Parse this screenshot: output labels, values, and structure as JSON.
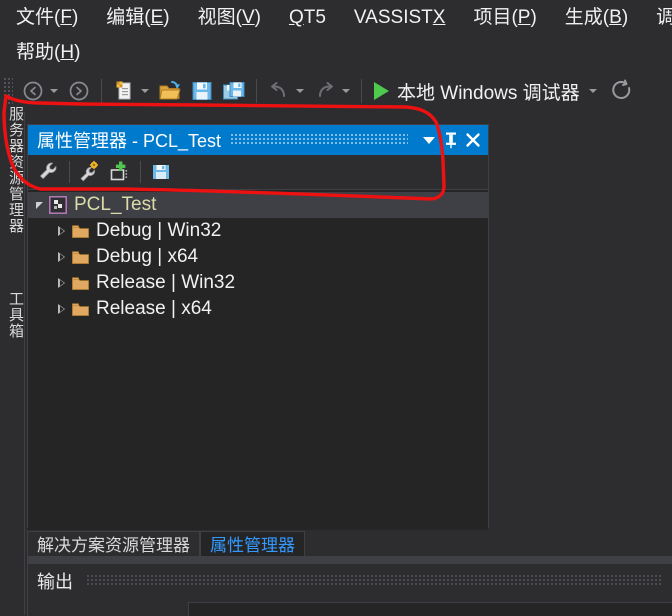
{
  "app": {
    "theme_background": "#2d2d30",
    "accent": "#007acc",
    "panel_background": "#252526"
  },
  "menubar": {
    "items": [
      {
        "name": "file",
        "text": "文件(F)",
        "pre": "文件(",
        "accel": "F",
        "post": ")"
      },
      {
        "name": "edit",
        "text": "编辑(E)",
        "pre": "编辑(",
        "accel": "E",
        "post": ")"
      },
      {
        "name": "view",
        "text": "视图(V)",
        "pre": "视图(",
        "accel": "V",
        "post": ")"
      },
      {
        "name": "qt5",
        "text": "QT5",
        "pre": "",
        "accel": "Q",
        "post": "T5"
      },
      {
        "name": "vassistx",
        "text": "VASSISTX",
        "pre": "VASSIST",
        "accel": "X",
        "post": ""
      },
      {
        "name": "project",
        "text": "项目(P)",
        "pre": "项目(",
        "accel": "P",
        "post": ")"
      },
      {
        "name": "build",
        "text": "生成(B)",
        "pre": "生成(",
        "accel": "B",
        "post": ")"
      },
      {
        "name": "debug",
        "text": "调试(D",
        "pre": "调试(",
        "accel": "D",
        "post": ""
      },
      {
        "name": "help",
        "text": "帮助(H)",
        "pre": "帮助(",
        "accel": "H",
        "post": ")"
      }
    ]
  },
  "toolbar": {
    "back_label": "navigate-backward",
    "forward_label": "navigate-forward",
    "new_label": "new-project",
    "open_label": "open-file",
    "save_label": "save",
    "save_all_label": "save-all",
    "undo_label": "undo",
    "redo_label": "redo",
    "run_label": "本地 Windows 调试器",
    "refresh_label": "refresh"
  },
  "left_strip": {
    "tabs": [
      {
        "name": "server-explorer",
        "label": "服务器资源管理器"
      },
      {
        "name": "toolbox",
        "label": "工具箱"
      }
    ]
  },
  "panel": {
    "title": "属性管理器 - PCL_Test",
    "dropdown_label": "window-menu",
    "pin_label": "auto-hide",
    "close_label": "close",
    "toolbar": [
      {
        "name": "property-manager-properties",
        "label": "属性"
      },
      {
        "name": "add-existing-property-sheet",
        "label": "添加现有属性表"
      },
      {
        "name": "add-new-project-property-sheet",
        "label": "添加新项目属性表"
      },
      {
        "name": "save-property-sheet",
        "label": "保存"
      }
    ],
    "tree": {
      "root": {
        "name": "PCL_Test",
        "label": "PCL_Test",
        "icon": "solution-icon",
        "expanded": true
      },
      "children": [
        {
          "name": "debug-win32",
          "label": "Debug | Win32",
          "icon": "folder-icon",
          "expanded": false
        },
        {
          "name": "debug-x64",
          "label": "Debug | x64",
          "icon": "folder-icon",
          "expanded": false
        },
        {
          "name": "release-win32",
          "label": "Release | Win32",
          "icon": "folder-icon",
          "expanded": false
        },
        {
          "name": "release-x64",
          "label": "Release | x64",
          "icon": "folder-icon",
          "expanded": false
        }
      ]
    }
  },
  "bottom_tabs": {
    "items": [
      {
        "name": "solution-explorer",
        "label": "解决方案资源管理器",
        "active": false
      },
      {
        "name": "property-manager",
        "label": "属性管理器",
        "active": true
      }
    ]
  },
  "output": {
    "title": "输出"
  },
  "annotation": {
    "color": "#ee1111",
    "shape": "hand-drawn-loop-around-property-manager-panel"
  }
}
